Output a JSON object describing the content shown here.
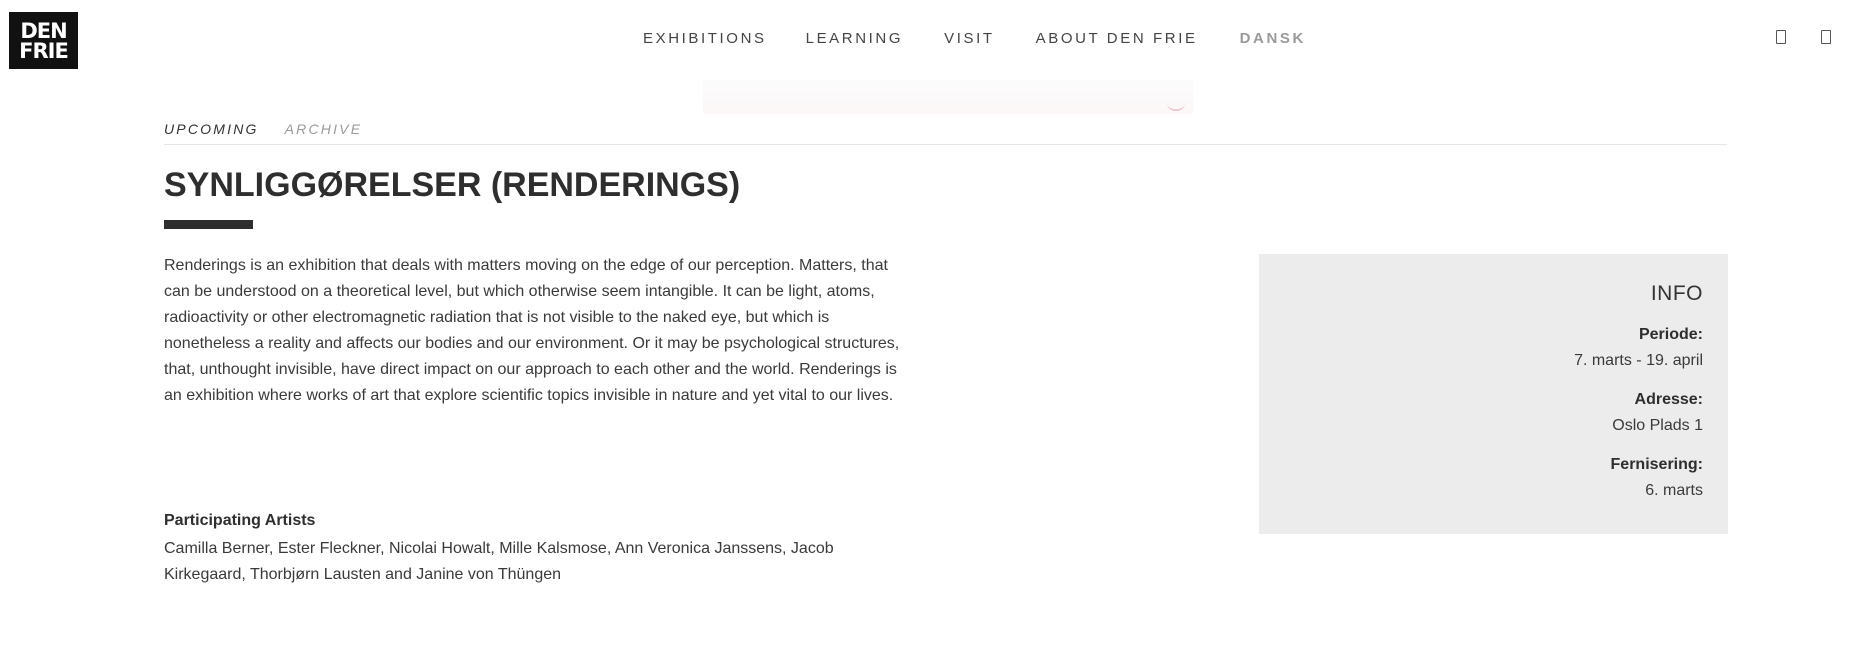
{
  "logo": {
    "line1": "DEN",
    "line2": "FRIE"
  },
  "nav": {
    "exhibitions": "EXHIBITIONS",
    "learning": "LEARNING",
    "visit": "VISIT",
    "about": "ABOUT DEN FRIE",
    "language": "DANSK"
  },
  "header_icons": [
    "box-icon",
    "box-icon"
  ],
  "subtabs": {
    "upcoming": "UPCOMING",
    "archive": "ARCHIVE"
  },
  "title": "SYNLIGGØRELSER (RENDERINGS)",
  "description": "Renderings is an exhibition that deals with matters moving on the edge of our perception. Matters, that can be understood on a theoretical level, but which otherwise seem intangible. It can be light, atoms, radioactivity or other electromagnetic radiation that is not visible to the naked eye, but which is nonetheless a reality and affects our bodies and our environment. Or it may be psychological structures, that, unthought invisible, have direct impact on our approach to each other and the world. Renderings is an exhibition where works of art that explore scientific topics invisible in nature and yet vital to our lives.",
  "artists": {
    "heading": "Participating Artists",
    "list": "Camilla Berner, Ester Fleckner, Nicolai Howalt, Mille Kalsmose, Ann Veronica Janssens, Jacob Kirkegaard, Thorbjørn Lausten and Janine von Thüngen"
  },
  "info": {
    "title": "INFO",
    "period_label": "Periode:",
    "period_value": "7. marts - 19. april",
    "address_label": "Adresse:",
    "address_value": "Oslo Plads 1",
    "opening_label": "Fernisering:",
    "opening_value": "6. marts"
  },
  "colors": {
    "text": "#333333",
    "muted": "#9a9a9a",
    "panel": "#ececec",
    "logo_bg": "#111111"
  }
}
